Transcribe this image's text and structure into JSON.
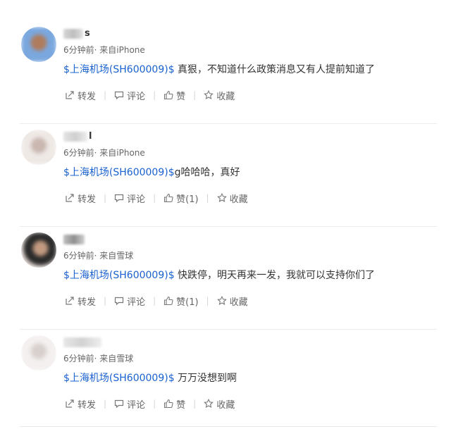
{
  "actions": {
    "repost": "转发",
    "comment": "评论",
    "like": "赞",
    "favorite": "收藏"
  },
  "posts": [
    {
      "username_visible": "s",
      "time": "6分钟前",
      "source": "· 来自iPhone",
      "stock_tag": "$上海机场(SH600009)$",
      "text": " 真狠，不知道什么政策消息又有人提前知道了",
      "like_label": "赞",
      "avatar_colors": [
        "#7aa7de",
        "#b07c5e",
        "#3d2a22"
      ]
    },
    {
      "username_visible": "l",
      "time": "6分钟前",
      "source": "· 来自iPhone",
      "stock_tag": "$上海机场(SH600009)$",
      "text": "g哈哈哈，真好",
      "like_label": "赞(1)",
      "avatar_colors": [
        "#efe9e6",
        "#c9b7b0",
        "#a08a84"
      ]
    },
    {
      "username_visible": "",
      "time": "6分钟前",
      "source": "· 来自雪球",
      "stock_tag": "$上海机场(SH600009)$",
      "text": " 快跌停，明天再来一发，我就可以支持你们了",
      "like_label": "赞(1)",
      "avatar_colors": [
        "#2b2b2b",
        "#c29a80",
        "#e0d6d2"
      ]
    },
    {
      "username_visible": "",
      "time": "6分钟前",
      "source": "· 来自雪球",
      "stock_tag": "$上海机场(SH600009)$",
      "text": " 万万没想到啊",
      "like_label": "赞",
      "avatar_colors": [
        "#f3f0ef",
        "#d8d0cd",
        "#b8aeab"
      ]
    }
  ],
  "icons": {
    "repost": "repost-icon",
    "comment": "comment-icon",
    "like": "thumbs-up-icon",
    "favorite": "star-icon"
  },
  "colors": {
    "stock_link": "#1961d0",
    "meta": "#666666",
    "text": "#333333"
  }
}
